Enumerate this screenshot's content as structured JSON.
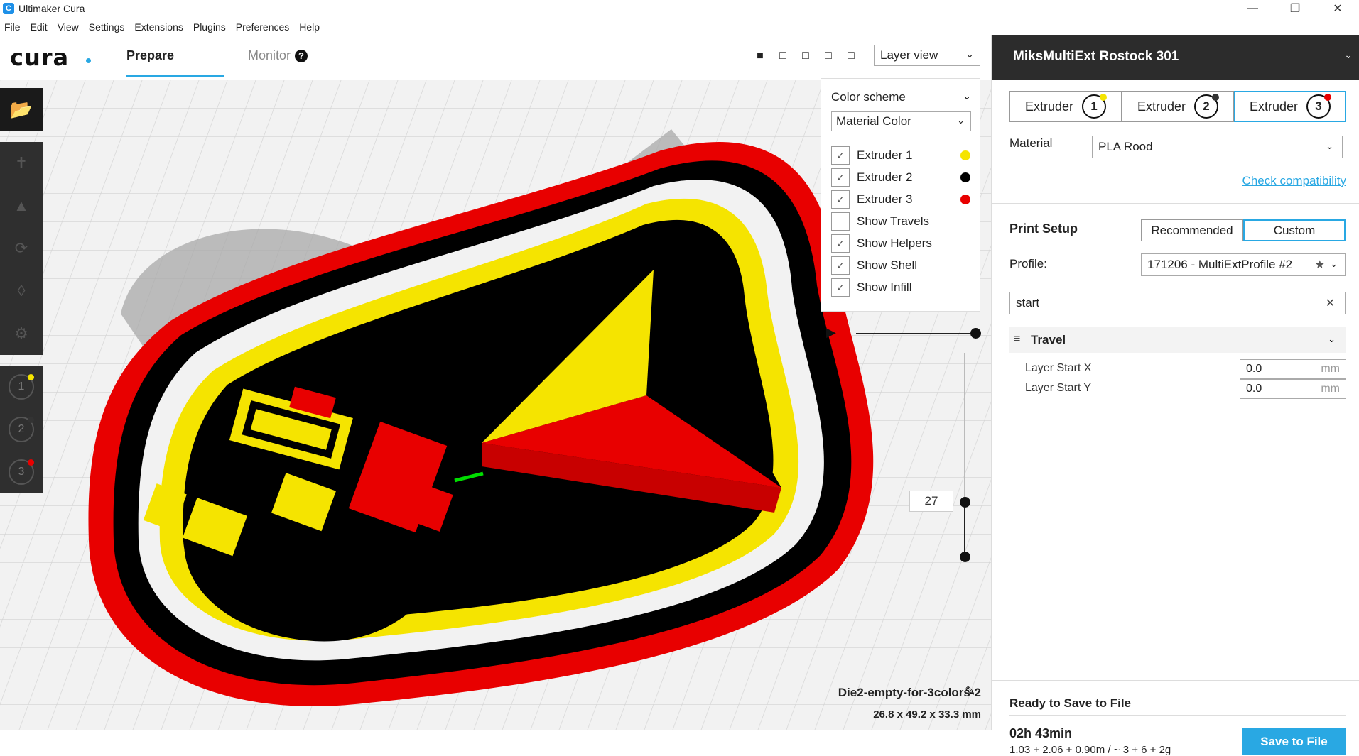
{
  "window": {
    "title": "Ultimaker Cura",
    "app_icon": "C",
    "minimize": "—",
    "maximize": "❐",
    "close": "✕"
  },
  "menu": [
    "File",
    "Edit",
    "View",
    "Settings",
    "Extensions",
    "Plugins",
    "Preferences",
    "Help"
  ],
  "topbar": {
    "logo": "cura",
    "tab_prepare": "Prepare",
    "tab_monitor": "Monitor",
    "help_glyph": "?",
    "view_mode": "Layer view"
  },
  "color_panel": {
    "heading": "Color scheme",
    "scheme": "Material Color",
    "items": [
      {
        "label": "Extruder 1",
        "checked": true,
        "color": "#f5e400"
      },
      {
        "label": "Extruder 2",
        "checked": true,
        "color": "#000000"
      },
      {
        "label": "Extruder 3",
        "checked": true,
        "color": "#e80000"
      },
      {
        "label": "Show Travels",
        "checked": false
      },
      {
        "label": "Show Helpers",
        "checked": true
      },
      {
        "label": "Show Shell",
        "checked": true
      },
      {
        "label": "Show Infill",
        "checked": true
      }
    ]
  },
  "layer_slider": {
    "current_layer": "27"
  },
  "model": {
    "name": "Die2-empty-for-3colors-2",
    "dimensions": "26.8 x 49.2 x 33.3 mm"
  },
  "sidebar": {
    "printer": "MiksMultiExt Rostock 301",
    "extruders": [
      {
        "label": "Extruder",
        "number": "1",
        "color": "#f5e400"
      },
      {
        "label": "Extruder",
        "number": "2",
        "color": "#333333"
      },
      {
        "label": "Extruder",
        "number": "3",
        "color": "#e80000"
      }
    ],
    "material_label": "Material",
    "material_value": "PLA Rood",
    "check_compat": "Check compatibility",
    "print_setup_label": "Print Setup",
    "mode_recommended": "Recommended",
    "mode_custom": "Custom",
    "profile_label": "Profile:",
    "profile_value": "171206 - MultiExtProfile #2",
    "search_value": "start",
    "travel_label": "Travel",
    "settings": [
      {
        "label": "Layer Start X",
        "value": "0.0",
        "unit": "mm"
      },
      {
        "label": "Layer Start Y",
        "value": "0.0",
        "unit": "mm"
      }
    ],
    "ready_label": "Ready to Save to File",
    "print_time": "02h 43min",
    "material_usage": "1.03 + 2.06 + 0.90m / ~ 3 + 6 + 2g",
    "save_button": "Save to File"
  },
  "colors": {
    "accent": "#29a8e3",
    "extruder1": "#f5e400",
    "extruder2": "#000000",
    "extruder3": "#e80000"
  }
}
